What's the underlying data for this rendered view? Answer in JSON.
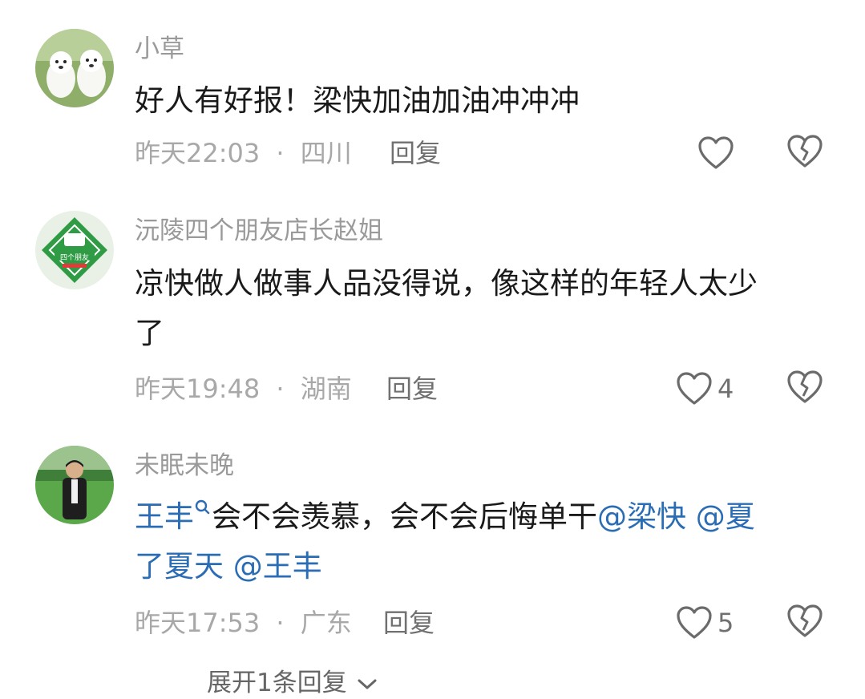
{
  "comments": [
    {
      "username": "小草",
      "text": "好人有好报！梁快加油加油冲冲冲",
      "time": "昨天22:03",
      "location": "四川",
      "reply_label": "回复",
      "likes": ""
    },
    {
      "username": "沅陵四个朋友店长赵姐",
      "text_line1": "凉快做人做事人品没得说，像这样的年轻人太少",
      "text_line2": "了",
      "avatar_text": "四个朋友",
      "time": "昨天19:48",
      "location": "湖南",
      "reply_label": "回复",
      "likes": "4"
    },
    {
      "username": "未眠未晚",
      "mention1": "王丰",
      "text_mid": "会不会羡慕，会不会后悔单干",
      "mention2": "@梁快",
      "mention3": "@夏",
      "mention3b": "了夏天",
      "mention4": "@王丰",
      "time": "昨天17:53",
      "location": "广东",
      "reply_label": "回复",
      "likes": "5"
    }
  ],
  "meta_separator": "·",
  "expand_label": "展开1条回复",
  "colors": {
    "mention": "#2a6db5",
    "username": "#9a9a9a",
    "meta": "#a8a8a8"
  },
  "icons": [
    "heart-icon",
    "broken-heart-icon",
    "search-icon",
    "chevron-down-icon"
  ]
}
